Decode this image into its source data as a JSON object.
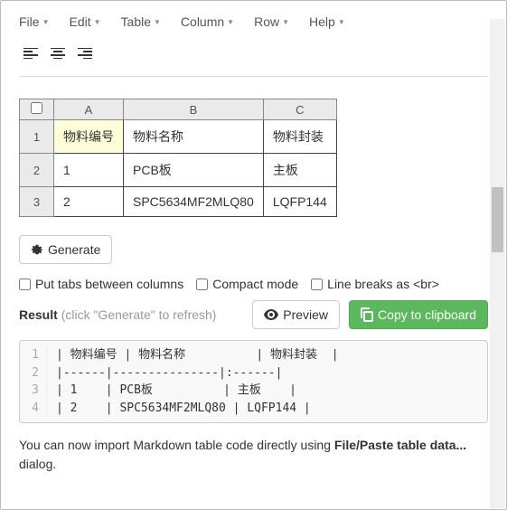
{
  "menu": {
    "file": "File",
    "edit": "Edit",
    "table": "Table",
    "column": "Column",
    "row": "Row",
    "help": "Help"
  },
  "columns": [
    "A",
    "B",
    "C"
  ],
  "rows": [
    {
      "n": "1",
      "cells": [
        "物料编号",
        "物料名称",
        "物料封装"
      ]
    },
    {
      "n": "2",
      "cells": [
        "1",
        "PCB板",
        "主板"
      ]
    },
    {
      "n": "3",
      "cells": [
        "2",
        "SPC5634MF2MLQ80",
        "LQFP144"
      ]
    }
  ],
  "active": {
    "row": 0,
    "col": 0
  },
  "buttons": {
    "generate": "Generate",
    "preview": "Preview",
    "copy": "Copy to clipboard"
  },
  "checks": {
    "tabs": "Put tabs between columns",
    "compact": "Compact mode",
    "br": "Line breaks as <br>"
  },
  "result": {
    "label": "Result",
    "hint": "(click \"Generate\" to refresh)"
  },
  "code": [
    "| 物料编号 | 物料名称          | 物料封装  |",
    "|------|---------------|:------|",
    "| 1    | PCB板          | 主板    |",
    "| 2    | SPC5634MF2MLQ80 | LQFP144 |"
  ],
  "footer": {
    "pre": "You can now import Markdown table code directly using ",
    "bold": "File/Paste table data...",
    "post": " dialog."
  }
}
